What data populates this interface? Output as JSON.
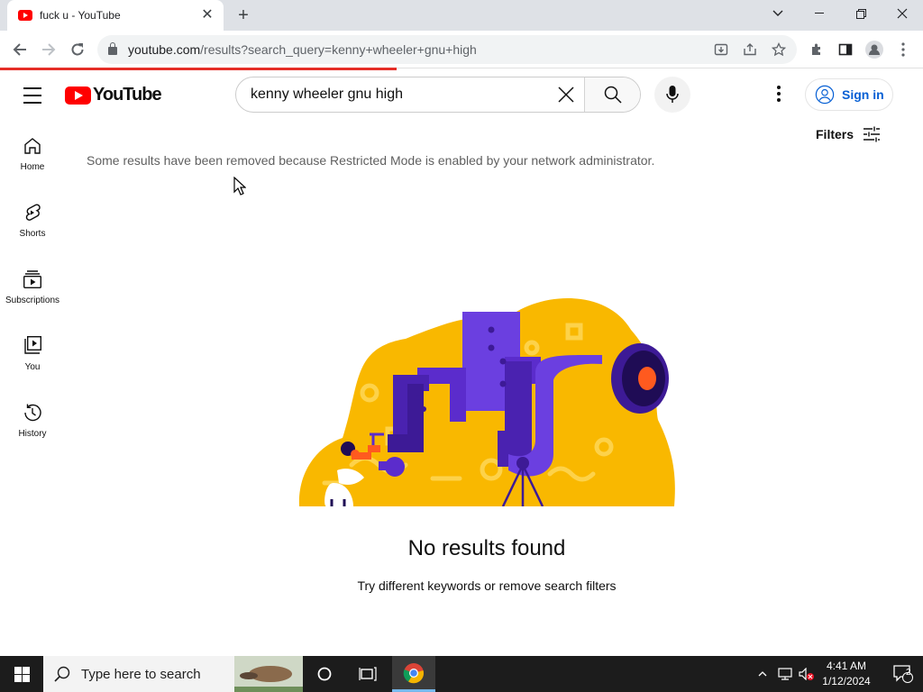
{
  "browser": {
    "tab_title": "fuck u - YouTube",
    "tab_close": "✕",
    "new_tab": "+",
    "url_host": "youtube.com",
    "url_path": "/results?search_query=kenny+wheeler+gnu+high",
    "page_load_progress_pct": 43
  },
  "masthead": {
    "logo_text": "YouTube",
    "search_value": "kenny wheeler gnu high",
    "signin_label": "Sign in"
  },
  "sidebar": {
    "items": [
      {
        "label": "Home",
        "icon": "home-icon"
      },
      {
        "label": "Shorts",
        "icon": "shorts-icon"
      },
      {
        "label": "Subscriptions",
        "icon": "subscriptions-icon"
      },
      {
        "label": "You",
        "icon": "you-icon"
      },
      {
        "label": "History",
        "icon": "history-icon"
      }
    ]
  },
  "content": {
    "filters_label": "Filters",
    "restricted_notice": "Some results have been removed because Restricted Mode is enabled by your network administrator.",
    "empty_title": "No results found",
    "empty_hint": "Try different keywords or remove search filters"
  },
  "taskbar": {
    "search_placeholder": "Type here to search",
    "time": "4:41 AM",
    "date": "1/12/2024",
    "notification_count": "2"
  },
  "colors": {
    "yt_red": "#ff0000",
    "link_blue": "#065fd4",
    "illus_yellow": "#f9b800",
    "illus_purple": "#5b2ccc",
    "illus_orange": "#ff5a1f",
    "taskbar": "#1c1c1c"
  }
}
